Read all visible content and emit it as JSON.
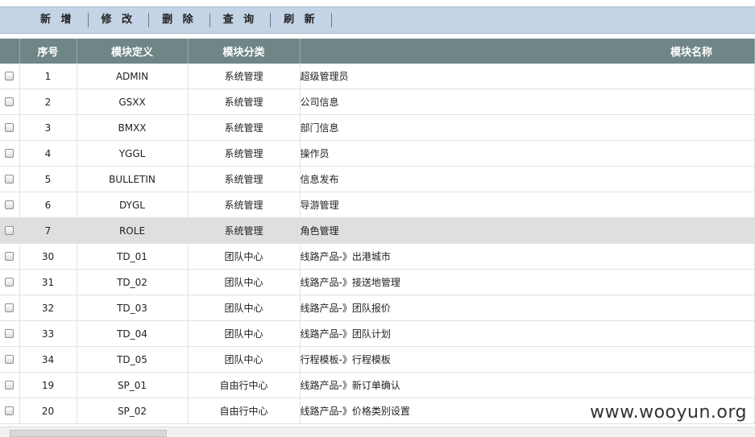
{
  "toolbar": {
    "buttons": [
      "新 增",
      "修 改",
      "删 除",
      "查 询",
      "刷 新"
    ]
  },
  "table": {
    "columns": [
      "序号",
      "模块定义",
      "模块分类",
      "模块名称"
    ],
    "rows": [
      {
        "no": "1",
        "code": "ADMIN",
        "category": "系统管理",
        "name": "超级管理员"
      },
      {
        "no": "2",
        "code": "GSXX",
        "category": "系统管理",
        "name": "公司信息"
      },
      {
        "no": "3",
        "code": "BMXX",
        "category": "系统管理",
        "name": "部门信息"
      },
      {
        "no": "4",
        "code": "YGGL",
        "category": "系统管理",
        "name": "操作员"
      },
      {
        "no": "5",
        "code": "BULLETIN",
        "category": "系统管理",
        "name": "信息发布"
      },
      {
        "no": "6",
        "code": "DYGL",
        "category": "系统管理",
        "name": "导游管理"
      },
      {
        "no": "7",
        "code": "ROLE",
        "category": "系统管理",
        "name": "角色管理"
      },
      {
        "no": "30",
        "code": "TD_01",
        "category": "团队中心",
        "name": "线路产品-》出港城市"
      },
      {
        "no": "31",
        "code": "TD_02",
        "category": "团队中心",
        "name": "线路产品-》接送地管理"
      },
      {
        "no": "32",
        "code": "TD_03",
        "category": "团队中心",
        "name": "线路产品-》团队报价"
      },
      {
        "no": "33",
        "code": "TD_04",
        "category": "团队中心",
        "name": "线路产品-》团队计划"
      },
      {
        "no": "34",
        "code": "TD_05",
        "category": "团队中心",
        "name": "行程模板-》行程模板"
      },
      {
        "no": "19",
        "code": "SP_01",
        "category": "自由行中心",
        "name": "线路产品-》新订单确认"
      },
      {
        "no": "20",
        "code": "SP_02",
        "category": "自由行中心",
        "name": "线路产品-》价格类别设置"
      }
    ],
    "selected_row": 6
  },
  "watermark": "www.wooyun.org"
}
